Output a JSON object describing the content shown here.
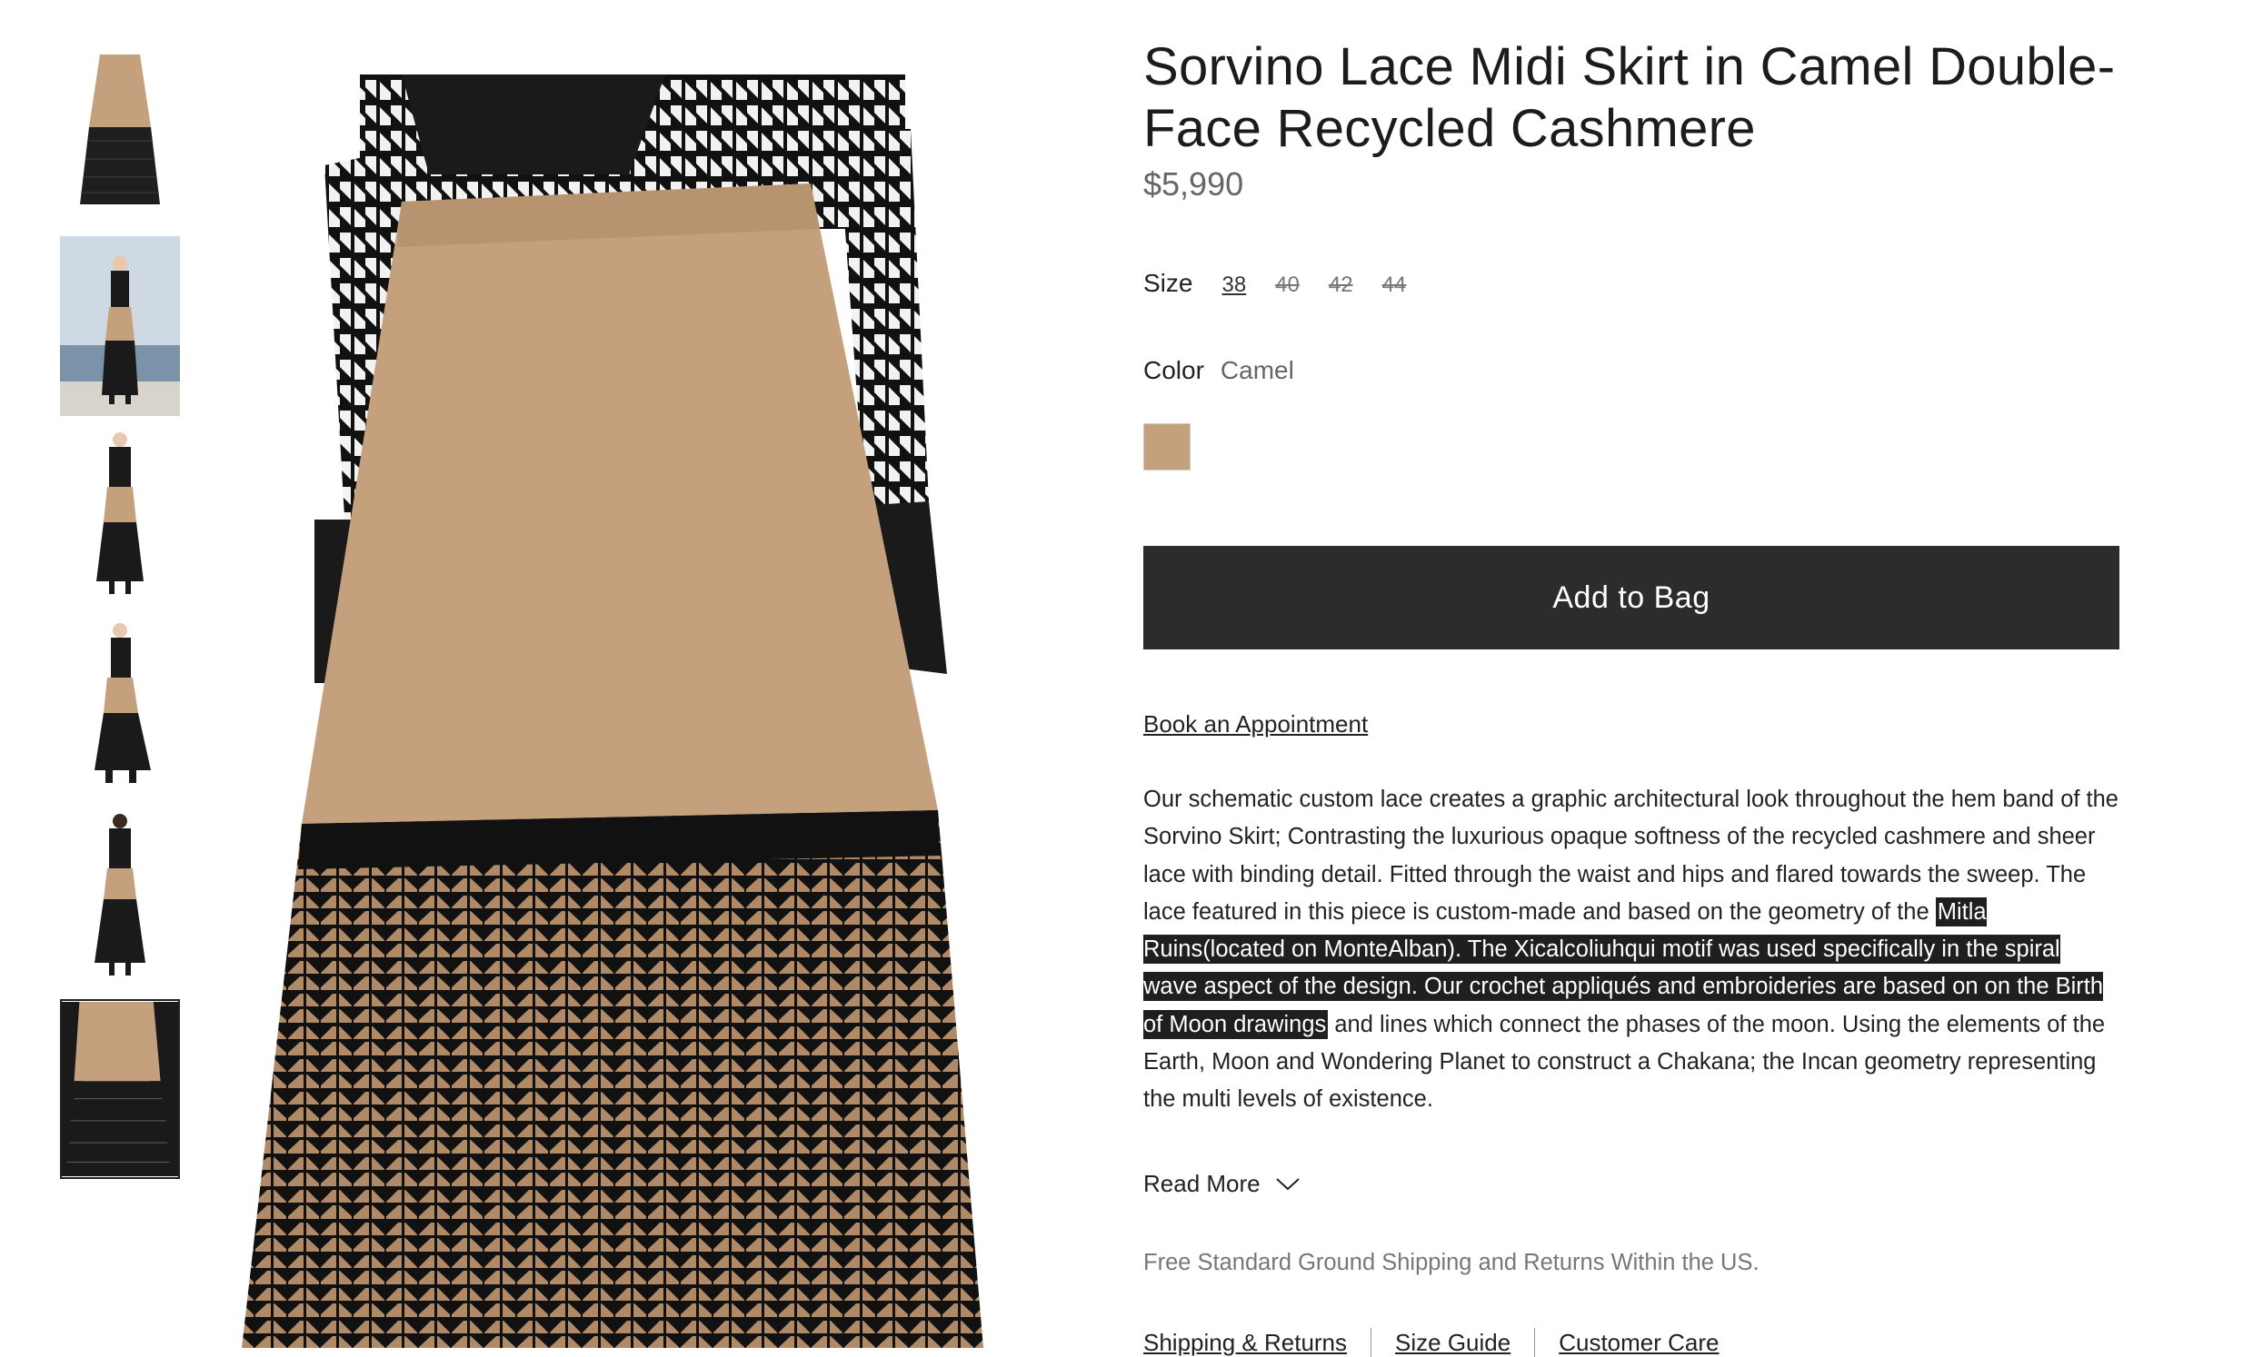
{
  "product": {
    "title": "Sorvino Lace Midi Skirt in Camel Double-Face Recycled Cashmere",
    "price": "$5,990"
  },
  "size": {
    "label": "Size",
    "options": [
      {
        "label": "38",
        "available": true,
        "selected": true
      },
      {
        "label": "40",
        "available": false,
        "selected": false
      },
      {
        "label": "42",
        "available": false,
        "selected": false
      },
      {
        "label": "44",
        "available": false,
        "selected": false
      }
    ]
  },
  "color": {
    "label": "Color",
    "value": "Camel",
    "swatch_hex": "#c4a07c"
  },
  "actions": {
    "add_to_bag": "Add to Bag",
    "book_appointment": "Book an Appointment",
    "read_more": "Read More"
  },
  "description": {
    "before": "Our schematic custom lace creates a graphic architectural look throughout the hem band of the Sorvino Skirt; Contrasting the luxurious opaque softness of the recycled cashmere and sheer lace with binding detail. Fitted through the waist and hips and flared towards the sweep. The lace featured in this piece is custom-made and based on the geometry of the ",
    "highlighted": "Mitla Ruins(located on MonteAlban). The Xicalcoliuhqui motif was used specifically in the spiral wave aspect of the design. Our crochet appliqués and embroideries are based on on the Birth of Moon drawings",
    "after": " and lines which connect the phases of the moon. Using the elements of the Earth, Moon and Wondering Planet to construct a Chakana; the Incan geometry representing the multi levels of existence."
  },
  "shipping_note": "Free Standard Ground Shipping and Returns Within the US.",
  "footer_links": [
    "Shipping & Returns",
    "Size Guide",
    "Customer Care"
  ],
  "gallery": {
    "thumbnail_count": 6,
    "selected_index": 5,
    "colors": {
      "camel": "#c4a07c",
      "lace": "#1a1a1a",
      "sky": "#cfd9e3",
      "sea": "#7a93a8"
    }
  }
}
